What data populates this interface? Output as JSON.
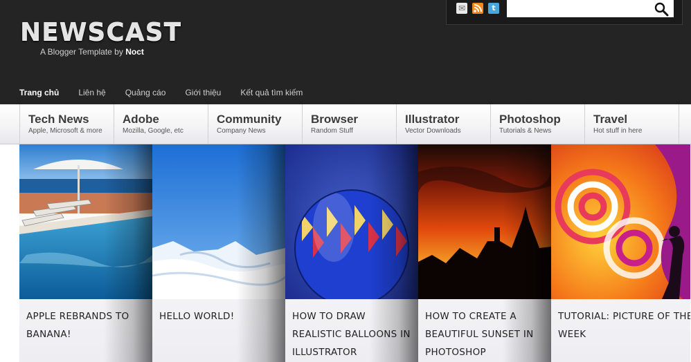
{
  "header": {
    "logo": "NEWSCAST",
    "tagline_prefix": "A Blogger Template by",
    "tagline_author": "Noct",
    "social_icons": [
      "mail-icon",
      "rss-icon",
      "twitter-icon"
    ],
    "search": {
      "placeholder": "",
      "button_icon": "magnifier-icon"
    }
  },
  "topnav": [
    {
      "label": "Trang chủ",
      "active": true
    },
    {
      "label": "Liên hệ"
    },
    {
      "label": "Quảng cáo"
    },
    {
      "label": "Giới thiệu"
    },
    {
      "label": "Kết quả tìm kiếm"
    }
  ],
  "categories": [
    {
      "title": "Tech News",
      "sub": "Apple, Microsoft & more"
    },
    {
      "title": "Adobe",
      "sub": "Mozilla, Google, etc"
    },
    {
      "title": "Community",
      "sub": "Company News"
    },
    {
      "title": "Browser",
      "sub": "Random Stuff"
    },
    {
      "title": "Illustrator",
      "sub": "Vector Downloads"
    },
    {
      "title": "Photoshop",
      "sub": "Tutorials & News"
    },
    {
      "title": "Travel",
      "sub": "Hot stuff in here"
    }
  ],
  "slides": [
    {
      "title": "Apple rebrands to banana!"
    },
    {
      "title": "Hello World!"
    },
    {
      "title": "How to draw realistic balloons in Illustrator"
    },
    {
      "title": "How to create a beautiful sunset in Photoshop"
    },
    {
      "title": "Tutorial: Picture of the week"
    }
  ],
  "colors": {
    "header_bg": "#242424",
    "text": "#222222",
    "accent_rss": "#f08a1c",
    "accent_twitter": "#48a6dc"
  }
}
